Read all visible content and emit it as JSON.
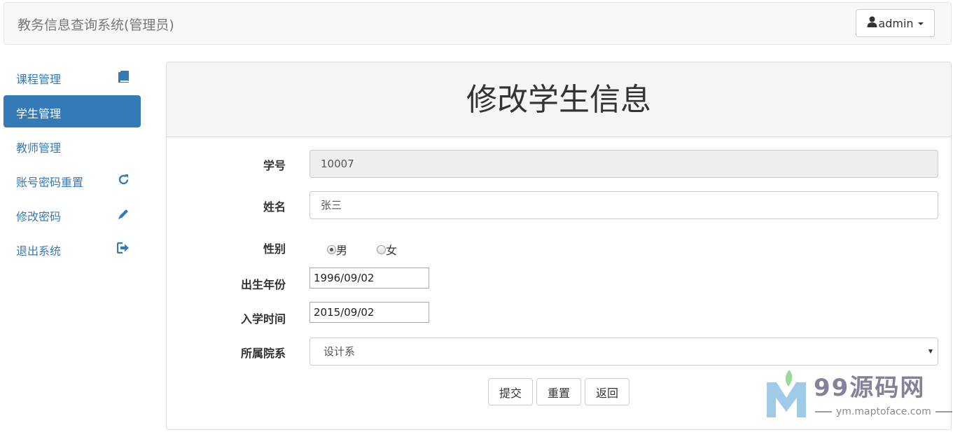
{
  "navbar": {
    "brand": "教务信息查询系统(管理员)",
    "user_label": "admin"
  },
  "sidebar": {
    "items": [
      {
        "label": "课程管理",
        "icon": "book-icon"
      },
      {
        "label": "学生管理",
        "icon": "",
        "active": true
      },
      {
        "label": "教师管理",
        "icon": ""
      },
      {
        "label": "账号密码重置",
        "icon": "refresh-icon"
      },
      {
        "label": "修改密码",
        "icon": "pencil-icon"
      },
      {
        "label": "退出系统",
        "icon": "logout-icon"
      }
    ]
  },
  "panel": {
    "title": "修改学生信息"
  },
  "form": {
    "student_id": {
      "label": "学号",
      "value": "10007"
    },
    "name": {
      "label": "姓名",
      "value": "张三"
    },
    "gender": {
      "label": "性别",
      "options": [
        "男",
        "女"
      ],
      "selected": "男"
    },
    "birth": {
      "label": "出生年份",
      "value": "1996/09/02"
    },
    "enroll": {
      "label": "入学时间",
      "value": "2015/09/02"
    },
    "department": {
      "label": "所属院系",
      "value": "设计系"
    },
    "buttons": {
      "submit": "提交",
      "reset": "重置",
      "back": "返回"
    }
  },
  "watermark": {
    "title": "99源码网",
    "url": "ym.maptoface.com"
  },
  "colors": {
    "primary": "#337ab7",
    "navbar_bg": "#f8f8f8",
    "panel_heading_bg": "#f5f5f5"
  }
}
